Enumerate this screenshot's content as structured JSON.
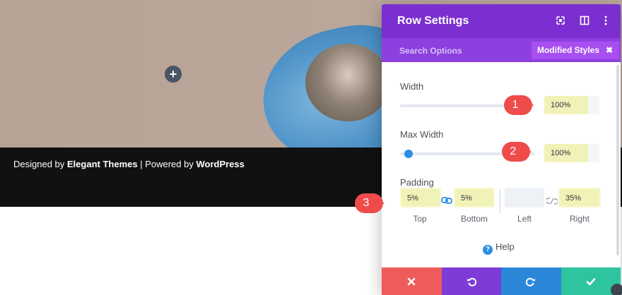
{
  "footer": {
    "prefix": "Designed by ",
    "brand1": "Elegant Themes",
    "sep": " | Powered by ",
    "brand2": "WordPress"
  },
  "modal": {
    "title": "Row Settings",
    "search_label": "Search Options",
    "modified_label": "Modified Styles",
    "modified_close": "✖"
  },
  "fields": {
    "width": {
      "label": "Width",
      "value": "100%"
    },
    "max_width": {
      "label": "Max Width",
      "value": "100%"
    },
    "padding": {
      "label": "Padding",
      "top": {
        "value": "5%",
        "caption": "Top"
      },
      "bottom": {
        "value": "5%",
        "caption": "Bottom"
      },
      "left": {
        "value": "",
        "caption": "Left"
      },
      "right": {
        "value": "35%",
        "caption": "Right"
      }
    }
  },
  "help_label": "Help",
  "callouts": [
    "1",
    "2",
    "3"
  ],
  "colors": {
    "header": "#7b2fd0",
    "subheader": "#8e3fe0",
    "modified_badge": "#a84ff0",
    "cancel": "#ef5b5b",
    "undo": "#7f3bd6",
    "redo": "#2b87da",
    "save": "#2ec4a0",
    "callout": "#f04b4b",
    "highlight": "#f0f2b8"
  },
  "icons": {
    "add": "plus-icon",
    "header": [
      "expand-icon",
      "split-view-icon",
      "more-vertical-icon"
    ],
    "actions": [
      "close-icon",
      "undo-icon",
      "redo-icon",
      "check-icon"
    ],
    "link_linked": "link-icon",
    "link_unlinked": "unlink-icon",
    "help": "question-icon"
  }
}
